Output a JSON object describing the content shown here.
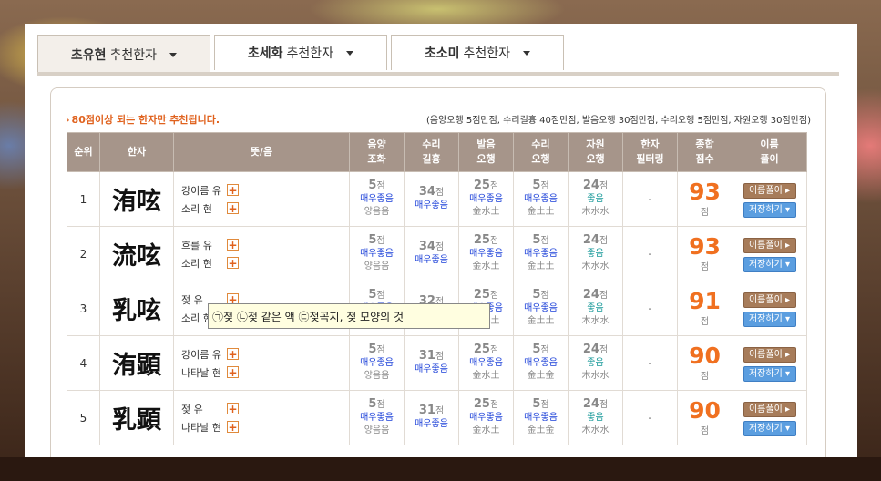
{
  "tabs": [
    {
      "name": "초유현",
      "rest": "추천한자",
      "active": true
    },
    {
      "name": "초세화",
      "rest": "추천한자",
      "active": false
    },
    {
      "name": "초소미",
      "rest": "추천한자",
      "active": false
    }
  ],
  "notice": "80점이상 되는 한자만 추천됩니다.",
  "criteria": "(음양오행 5점만점, 수리길흉 40점만점, 발음오행 30점만점, 수리오행 5점만점, 자원오행 30점만점)",
  "headers": [
    "순위",
    "한자",
    "뜻/음",
    "음양\n조화",
    "수리\n길흉",
    "발음\n오행",
    "수리\n오행",
    "자원\n오행",
    "한자\n필터링",
    "종합\n점수",
    "이름\n풀이"
  ],
  "point_unit": "점",
  "button_interpret": "이름풀이",
  "button_save": "저장하기",
  "filter_value": "-",
  "rows": [
    {
      "rank": "1",
      "hanja": "洧呟",
      "m1": "강이름 유",
      "m2": "소리 현",
      "yy": {
        "n": "5",
        "g": "매우좋음",
        "s": "양음음"
      },
      "sl": {
        "n": "34",
        "g": "매우좋음",
        "s": ""
      },
      "br": {
        "n": "25",
        "g": "매우좋음",
        "s": "金水土"
      },
      "so": {
        "n": "5",
        "g": "매우좋음",
        "s": "金土土"
      },
      "jw": {
        "n": "24",
        "g": "좋음",
        "s": "木水水"
      },
      "total": "93"
    },
    {
      "rank": "2",
      "hanja": "流呟",
      "m1": "흐를 유",
      "m2": "소리 현",
      "yy": {
        "n": "5",
        "g": "매우좋음",
        "s": "양음음"
      },
      "sl": {
        "n": "34",
        "g": "매우좋음",
        "s": ""
      },
      "br": {
        "n": "25",
        "g": "매우좋음",
        "s": "金水土"
      },
      "so": {
        "n": "5",
        "g": "매우좋음",
        "s": "金土土"
      },
      "jw": {
        "n": "24",
        "g": "좋음",
        "s": "木水水"
      },
      "total": "93"
    },
    {
      "rank": "3",
      "hanja": "乳呟",
      "m1": "젖 유",
      "m2": "소리 현",
      "yy": {
        "n": "5",
        "g": "매우좋음",
        "s": "양음음"
      },
      "sl": {
        "n": "32",
        "g": "매우좋음",
        "s": ""
      },
      "br": {
        "n": "25",
        "g": "매우좋음",
        "s": "金水土"
      },
      "so": {
        "n": "5",
        "g": "매우좋음",
        "s": "金土土"
      },
      "jw": {
        "n": "24",
        "g": "좋음",
        "s": "木水水"
      },
      "total": "91"
    },
    {
      "rank": "4",
      "hanja": "洧顕",
      "m1": "강이름 유",
      "m2": "나타날 현",
      "yy": {
        "n": "5",
        "g": "매우좋음",
        "s": "양음음"
      },
      "sl": {
        "n": "31",
        "g": "매우좋음",
        "s": ""
      },
      "br": {
        "n": "25",
        "g": "매우좋음",
        "s": "金水土"
      },
      "so": {
        "n": "5",
        "g": "매우좋음",
        "s": "金土金"
      },
      "jw": {
        "n": "24",
        "g": "좋음",
        "s": "木水水"
      },
      "total": "90"
    },
    {
      "rank": "5",
      "hanja": "乳顕",
      "m1": "젖 유",
      "m2": "나타날 현",
      "yy": {
        "n": "5",
        "g": "매우좋음",
        "s": "양음음"
      },
      "sl": {
        "n": "31",
        "g": "매우좋음",
        "s": ""
      },
      "br": {
        "n": "25",
        "g": "매우좋음",
        "s": "金水土"
      },
      "so": {
        "n": "5",
        "g": "매우좋음",
        "s": "金土金"
      },
      "jw": {
        "n": "24",
        "g": "좋음",
        "s": "木水水"
      },
      "total": "90"
    }
  ],
  "tooltip": "㉠젖 ㉡젖 같은 액 ㉢젖꼭지, 젖 모양의 것",
  "colors": {
    "header_bg": "#a6958a",
    "accent_orange": "#f07020",
    "good_blue": "#1a3fd8",
    "good_teal": "#1a9a9a"
  }
}
